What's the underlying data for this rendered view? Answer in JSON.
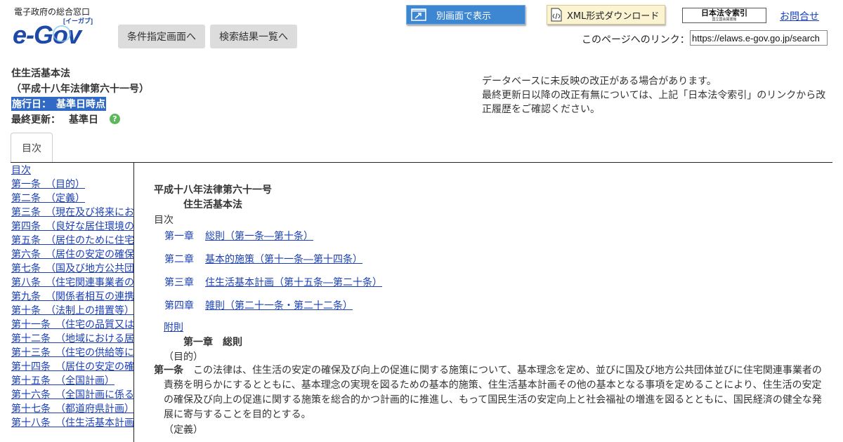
{
  "header": {
    "logo_subtitle": "電子政府の総合窓口",
    "logo_text": "e-Gov",
    "logo_ruby": "[イーガブ]",
    "btn_conditions": "条件指定画面へ",
    "btn_results": "検索結果一覧へ",
    "btn_new_window": "別画面で表示",
    "btn_xml": "XML形式ダウンロード",
    "law_index_title": "日本法令索引",
    "law_index_sub": "国立国会図書館",
    "contact": "お問合せ",
    "link_label": "このページへのリンク：",
    "link_value": "https://elaws.e-gov.go.jp/search"
  },
  "law": {
    "title": "住生活基本法",
    "number": "（平成十八年法律第六十一号）",
    "effective": "施行日：　基準日時点",
    "last_updated_label": "最終更新：",
    "last_updated_value": "基準日"
  },
  "notice": {
    "line1": "データベースに未反映の改正がある場合があります。",
    "line2": "最終更新日以降の改正有無については、上記「日本法令索引」のリンクから改正履歴をご確認ください。"
  },
  "tabs": {
    "toc": "目次"
  },
  "sidebar": {
    "items": [
      "目次",
      "第一条　（目的）",
      "第二条　（定義）",
      "第三条　（現在及び将来における国民の住生活の基盤である住宅の供給等）",
      "第四条　（良好な居住環境の形成）",
      "第五条　（居住のために住宅を購入する者等の利益の擁護及び増進）",
      "第六条　（居住の安定の確保）",
      "第七条　（国及び地方公共団体の責務）",
      "第八条　（住宅関連事業者の責務）",
      "第九条　（関係者相互の連携及び協力）",
      "第十条　（法制上の措置等）",
      "第十一条　（住宅の品質又は性能の維持及び向上）",
      "第十二条　（地域における居住環境の維持及び向上）",
      "第十三条　（住宅の供給等に係る適正な取引の確保）",
      "第十四条　（居住の安定の確保のために必要な住宅の供給の促進等）",
      "第十五条　（全国計画）",
      "第十六条　（全国計画に係る政策の評価）",
      "第十七条　（都道府県計画）",
      "第十八条　（住生活基本計画の実施）"
    ]
  },
  "document": {
    "number": "平成十八年法律第六十一号",
    "title": "住生活基本法",
    "toc_label": "目次",
    "toc": [
      {
        "chapter": "第一章",
        "title": "総則（第一条―第十条）"
      },
      {
        "chapter": "第二章",
        "title": "基本的施策（第十一条―第十四条）"
      },
      {
        "chapter": "第三章",
        "title": "住生活基本計画（第十五条―第二十条）"
      },
      {
        "chapter": "第四章",
        "title": "雑則（第二十一条・第二十二条）"
      }
    ],
    "supplementary": "附則",
    "chapter1_heading": "第一章　総則",
    "article1_caption": "（目的）",
    "article1_label": "第一条",
    "article1_text": "この法律は、住生活の安定の確保及び向上の促進に関する施策について、基本理念を定め、並びに国及び地方公共団体並びに住宅関連事業者の責務を明らかにするとともに、基本理念の実現を図るための基本的施策、住生活基本計画その他の基本となる事項を定めることにより、住生活の安定の確保及び向上の促進に関する施策を総合的かつ計画的に推進し、もって国民生活の安定向上と社会福祉の増進を図るとともに、国民経済の健全な発展に寄与することを目的とする。",
    "article2_caption": "（定義）"
  },
  "colors": {
    "link": "#1a3fb8",
    "new_window_btn": "#3d86d1",
    "xml_btn": "#fbf3d2",
    "highlight": "#316ac5",
    "help_icon": "#5cb85c"
  },
  "icons": {
    "new_window": "new-window-icon",
    "xml": "xml-file-icon",
    "help": "help-icon"
  }
}
